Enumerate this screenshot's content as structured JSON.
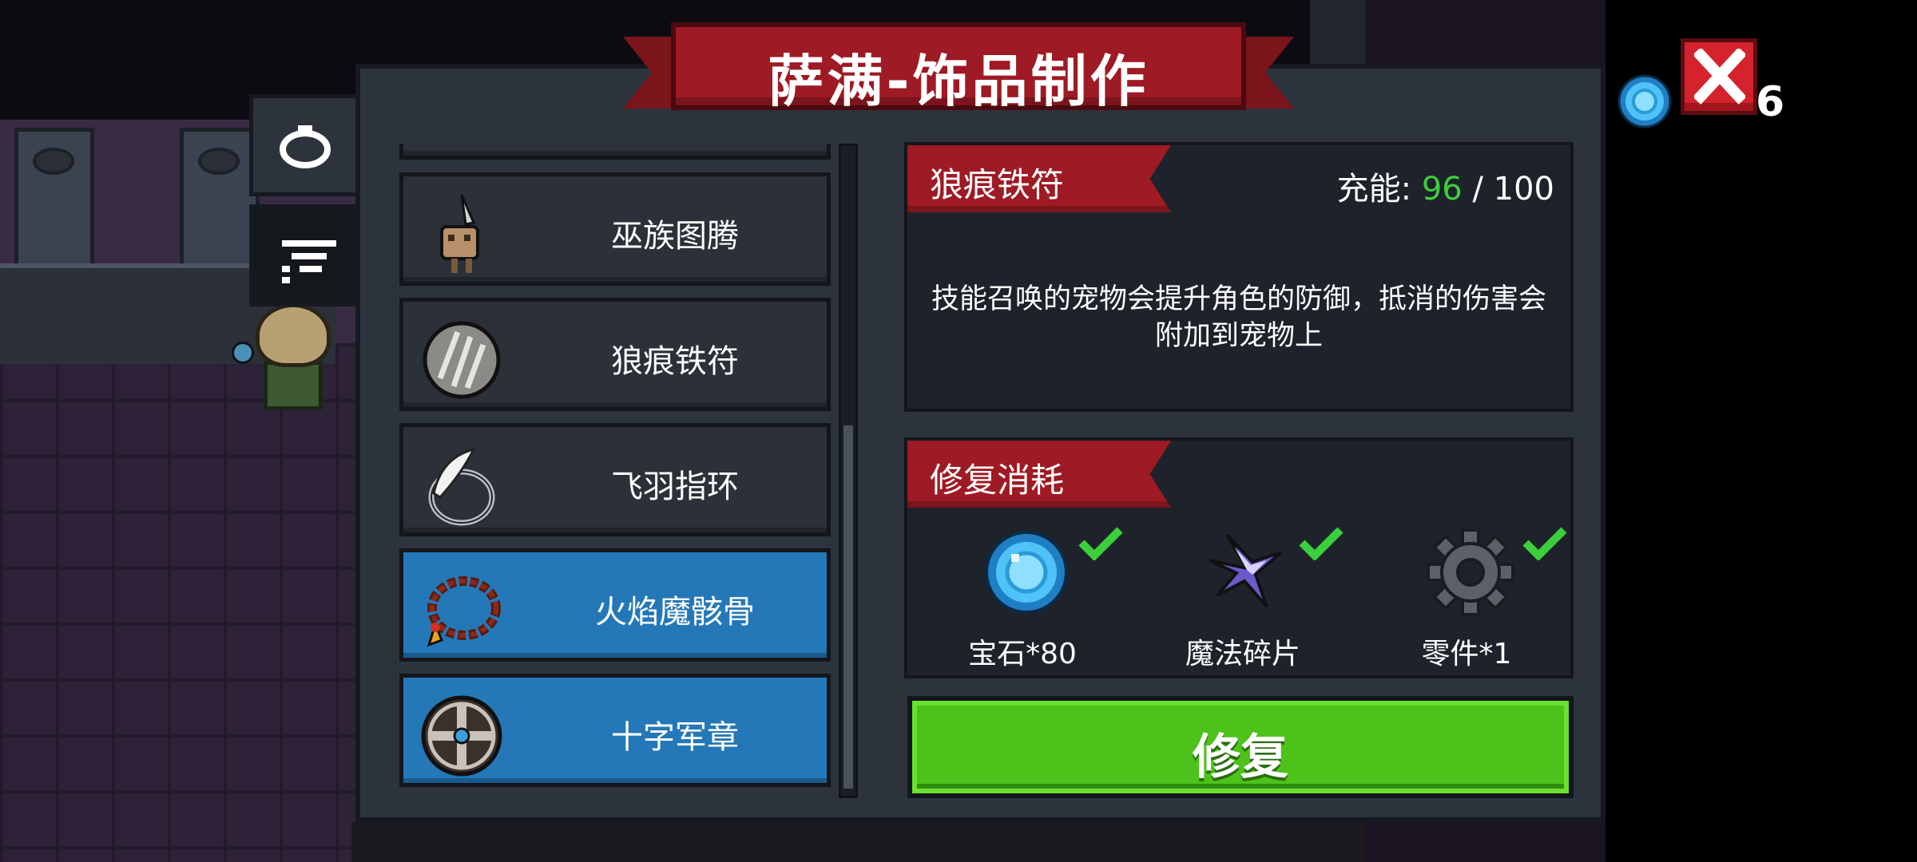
{
  "title": "萨满-饰品制作",
  "top_right": {
    "gem_count": "6"
  },
  "list": {
    "items": [
      {
        "label": "巫族图腾",
        "icon": "totem-icon",
        "selected": false
      },
      {
        "label": "狼痕铁符",
        "icon": "wolf-claw-talisman-icon",
        "selected": false
      },
      {
        "label": "飞羽指环",
        "icon": "feather-ring-icon",
        "selected": false
      },
      {
        "label": "火焰魔骸骨",
        "icon": "bead-necklace-icon",
        "selected": true
      },
      {
        "label": "十字军章",
        "icon": "cross-shield-badge-icon",
        "selected": true
      }
    ]
  },
  "detail": {
    "name": "狼痕铁符",
    "charge_label": "充能:",
    "charge_current": "96",
    "charge_sep": "/",
    "charge_max": "100",
    "description": "技能召唤的宠物会提升角色的防御，抵消的伤害会附加到宠物上"
  },
  "cost": {
    "header": "修复消耗",
    "items": [
      {
        "label": "宝石*80",
        "icon": "gem-icon",
        "satisfied": true
      },
      {
        "label": "魔法碎片",
        "icon": "magic-shard-icon",
        "satisfied": true
      },
      {
        "label": "零件*1",
        "icon": "gear-part-icon",
        "satisfied": true
      }
    ]
  },
  "repair_button": "修复",
  "colors": {
    "panel": "#2c333d",
    "ribbon_red": "#9e1a24",
    "selected_blue": "#2578b8",
    "button_green": "#4cc21a",
    "charge_green": "#3ccf3c"
  }
}
